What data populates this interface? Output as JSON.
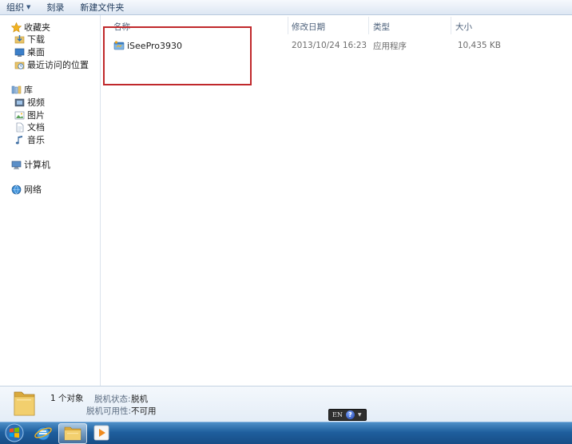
{
  "toolbar": {
    "organize_label": "组织",
    "burn_label": "刻录",
    "new_folder_label": "新建文件夹"
  },
  "sidebar": {
    "favorites": {
      "label": "收藏夹",
      "items": [
        {
          "label": "下载",
          "icon": "download-folder-icon"
        },
        {
          "label": "桌面",
          "icon": "desktop-icon"
        },
        {
          "label": "最近访问的位置",
          "icon": "recent-places-icon"
        }
      ]
    },
    "libraries": {
      "label": "库",
      "items": [
        {
          "label": "视频",
          "icon": "video-library-icon"
        },
        {
          "label": "图片",
          "icon": "picture-library-icon"
        },
        {
          "label": "文档",
          "icon": "document-library-icon"
        },
        {
          "label": "音乐",
          "icon": "music-library-icon"
        }
      ]
    },
    "computer": {
      "label": "计算机"
    },
    "network": {
      "label": "网络"
    }
  },
  "columns": {
    "name": "名称",
    "date": "修改日期",
    "type": "类型",
    "size": "大小"
  },
  "files": [
    {
      "name": "iSeePro3930",
      "date": "2013/10/24 16:23",
      "type": "应用程序",
      "size": "10,435 KB",
      "icon": "application-icon"
    }
  ],
  "details": {
    "count": "1 个对象",
    "offline_status_label": "脱机状态:",
    "offline_status_value": "脱机",
    "offline_avail_label": "脱机可用性:",
    "offline_avail_value": "不可用"
  },
  "language_bar": {
    "lang": "EN",
    "help": "?"
  },
  "colors": {
    "highlight": "#c0282b",
    "taskbar": "#1f5f9e"
  }
}
